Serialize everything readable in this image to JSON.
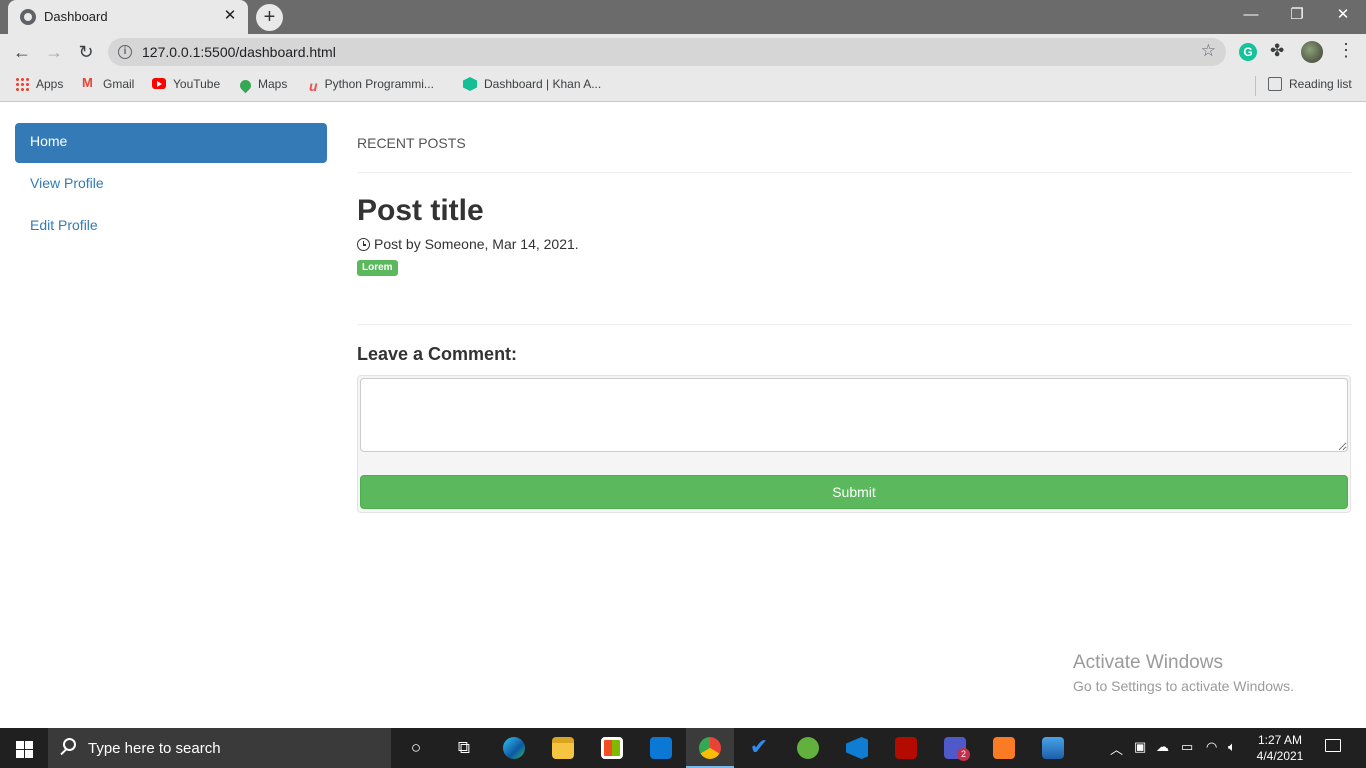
{
  "browser": {
    "tab_title": "Dashboard",
    "tab_close": "✕",
    "new_tab": "+",
    "window_controls": {
      "minimize": "—",
      "restore": "❐",
      "close": "✕"
    },
    "url": "127.0.0.1:5500/dashboard.html",
    "extension_grammarly": "G",
    "bookmarks": [
      {
        "label": "Apps",
        "icon": "apps-grid-icon"
      },
      {
        "label": "Gmail",
        "icon": "gmail-icon"
      },
      {
        "label": "YouTube",
        "icon": "youtube-icon"
      },
      {
        "label": "Maps",
        "icon": "maps-pin-icon"
      },
      {
        "label": "Python Programmi...",
        "icon": "udemy-icon"
      },
      {
        "label": "Dashboard | Khan A...",
        "icon": "khan-academy-icon"
      }
    ],
    "reading_list": "Reading list"
  },
  "sidebar": {
    "items": [
      {
        "label": "Home",
        "active": true
      },
      {
        "label": "View Profile",
        "active": false
      },
      {
        "label": "Edit Profile",
        "active": false
      }
    ]
  },
  "main": {
    "section_title": "RECENT POSTS",
    "post": {
      "title": "Post title",
      "meta": "Post by Someone, Mar 14, 2021.",
      "tag": "Lorem"
    },
    "comment": {
      "heading": "Leave a Comment:",
      "value": "",
      "submit_label": "Submit"
    }
  },
  "watermark": {
    "title": "Activate Windows",
    "subtitle": "Go to Settings to activate Windows."
  },
  "taskbar": {
    "search_placeholder": "Type here to search",
    "time": "1:27 AM",
    "date": "4/4/2021",
    "teams_badge": "2",
    "apps": [
      "cortana",
      "task-view",
      "edge",
      "file-explorer",
      "store",
      "mail",
      "chrome",
      "todo",
      "utorrent",
      "vscode",
      "acrobat",
      "teams",
      "xampp",
      "photos"
    ]
  },
  "colors": {
    "primary": "#337ab7",
    "success": "#5cb85c",
    "taskbar": "#202020"
  }
}
